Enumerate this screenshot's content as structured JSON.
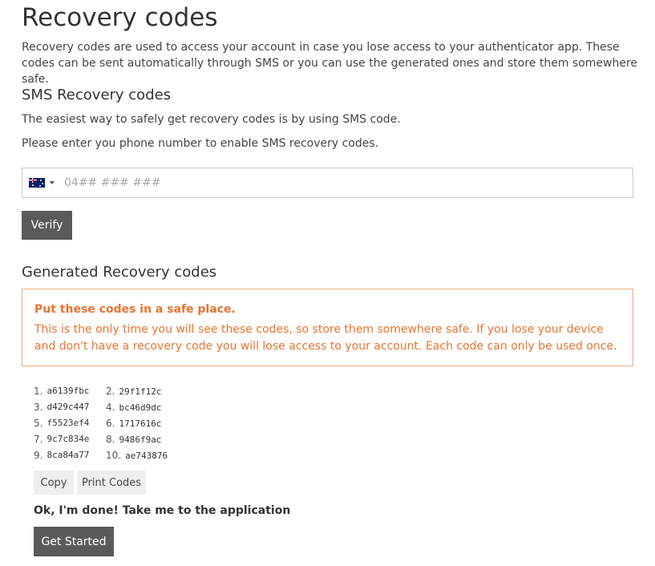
{
  "page": {
    "title": "Recovery codes",
    "intro": "Recovery codes are used to access your account in case you lose access to your authenticator app. These codes can be sent automatically through SMS or you can use the generated ones and store them somewhere safe."
  },
  "sms": {
    "heading": "SMS Recovery codes",
    "line1": "The easiest way to safely get recovery codes is by using SMS code.",
    "line2": "Please enter you phone number to enable SMS recovery codes.",
    "phone_placeholder": "04## ### ###",
    "phone_value": "",
    "country_flag_icon": "australia-flag-icon",
    "verify_label": "Verify"
  },
  "generated": {
    "heading": "Generated Recovery codes",
    "alert_title": "Put these codes in a safe place.",
    "alert_body": "This is the only time you will see these codes, so store them somewhere safe. If you lose your device and don't have a recovery code you will lose access to your account. Each code can only be used once.",
    "codes": [
      {
        "n": "1.",
        "code": "a6139fbc"
      },
      {
        "n": "2.",
        "code": "29f1f12c"
      },
      {
        "n": "3.",
        "code": "d429c447"
      },
      {
        "n": "4.",
        "code": "bc46d9dc"
      },
      {
        "n": "5.",
        "code": "f5523ef4"
      },
      {
        "n": "6.",
        "code": "1717616c"
      },
      {
        "n": "7.",
        "code": "9c7c834e"
      },
      {
        "n": "8.",
        "code": "9486f9ac"
      },
      {
        "n": "9.",
        "code": "8ca84a77"
      },
      {
        "n": "10.",
        "code": "ae743876"
      }
    ],
    "copy_label": "Copy",
    "print_label": "Print Codes"
  },
  "finish": {
    "prompt": "Ok, I'm done! Take me to the application",
    "get_started_label": "Get Started"
  },
  "colors": {
    "warning": "#e9742f",
    "warning_border": "#f0a883",
    "dark_button": "#5a5a5a",
    "light_button": "#eeeeee"
  }
}
